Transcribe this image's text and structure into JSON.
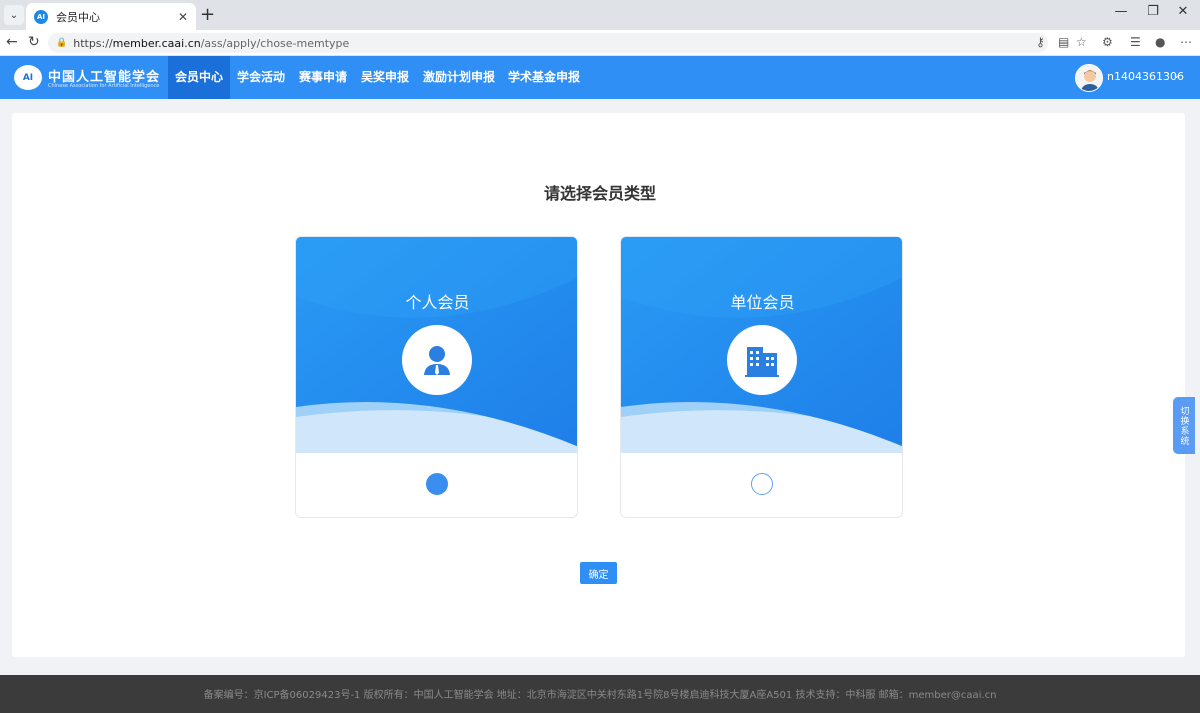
{
  "browser": {
    "tab_title": "会员中心",
    "tab_close": "✕",
    "new_tab": "+",
    "url_scheme": "https://",
    "url_host": "member.caai.cn",
    "url_path": "/ass/apply/chose-memtype"
  },
  "header": {
    "logo_badge": "AI",
    "logo_cn": "中国人工智能学会",
    "logo_en": "Chinese Association for Artificial Intelligence",
    "nav": [
      "会员中心",
      "学会活动",
      "赛事申请",
      "吴奖申报",
      "激励计划申报",
      "学术基金申报"
    ],
    "active_index": 0,
    "username": "n1404361306"
  },
  "main": {
    "title": "请选择会员类型",
    "cards": [
      {
        "label": "个人会员",
        "icon": "person-icon",
        "selected": true
      },
      {
        "label": "单位会员",
        "icon": "building-icon",
        "selected": false
      }
    ],
    "confirm_label": "确定"
  },
  "side_switch": "切换系统",
  "footer": "备案编号：京ICP备06029423号-1 版权所有：中国人工智能学会 地址：北京市海淀区中关村东路1号院8号楼启迪科技大厦A座A501 技术支持：中科服 邮箱：member@caai.cn",
  "colors": {
    "primary": "#2f8ff5",
    "active_nav": "#1b6fd8",
    "footer_bg": "#3b3b3b"
  }
}
